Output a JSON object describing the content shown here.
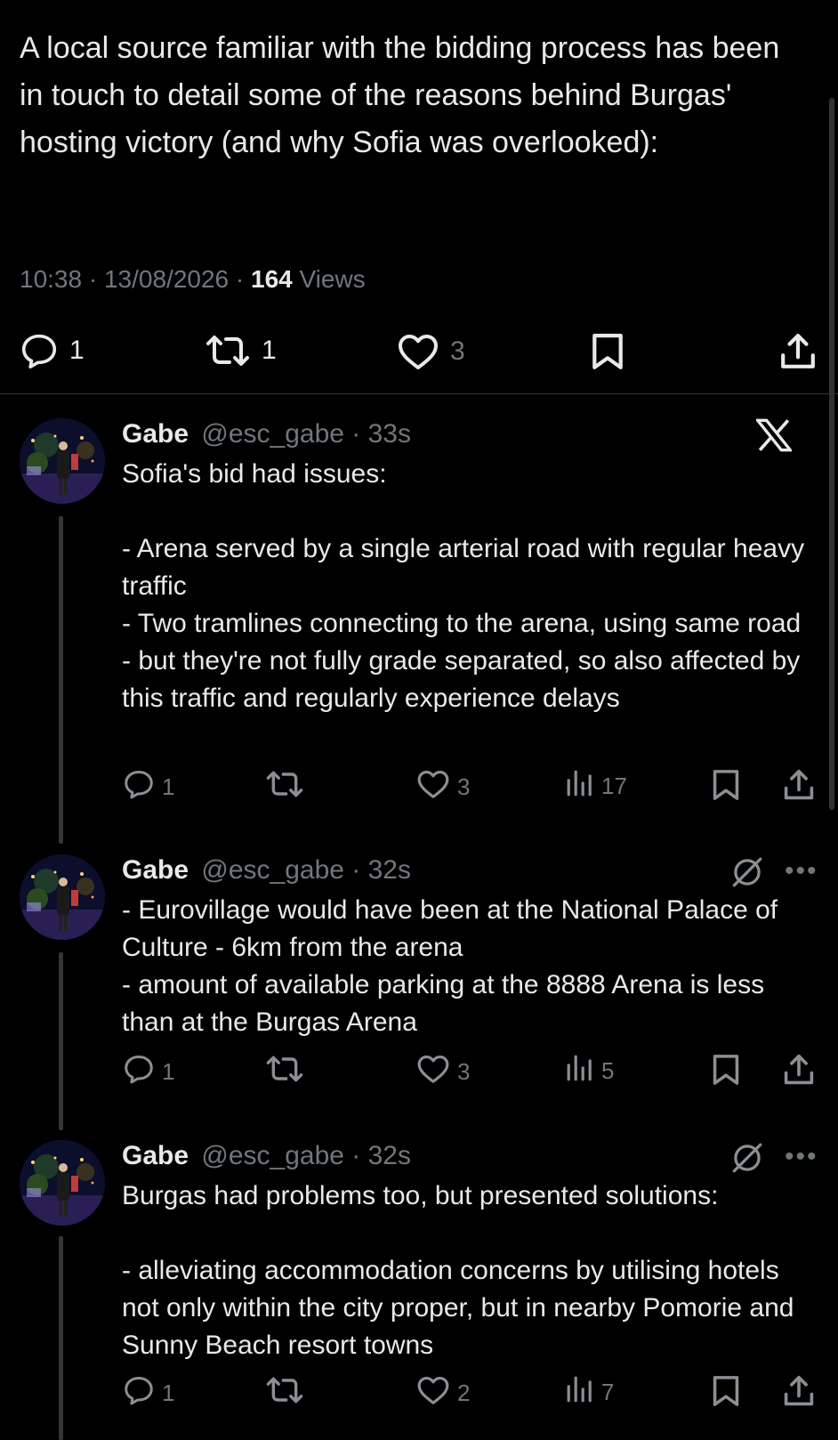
{
  "main_tweet": {
    "text": "A local source familiar with the bidding process has been in touch to detail some of the reasons behind Burgas' hosting victory (and why Sofia was overlooked):",
    "time": "10:38",
    "date": "13/08/2026",
    "views_count": "164",
    "views_label": "Views",
    "separator": "·",
    "actions": {
      "reply_count": "1",
      "retweet_count": "1",
      "like_count": "3"
    }
  },
  "replies": [
    {
      "name": "Gabe",
      "handle": "@esc_gabe",
      "time": "· 33s",
      "text": "Sofia's bid had issues:\n\n- Arena served by a single arterial road with regular heavy traffic\n- Two tramlines connecting to the arena, using same road - but they're not fully grade separated, so also affected by this traffic and regularly experience delays",
      "reply_count": "1",
      "retweet_count": "",
      "like_count": "3",
      "views_count": "17"
    },
    {
      "name": "Gabe",
      "handle": "@esc_gabe",
      "time": "· 32s",
      "text": "- Eurovillage would have been at the National Palace of Culture - 6km from the arena\n- amount of available parking at the 8888 Arena is less than at the Burgas Arena",
      "reply_count": "1",
      "retweet_count": "",
      "like_count": "3",
      "views_count": "5"
    },
    {
      "name": "Gabe",
      "handle": "@esc_gabe",
      "time": "· 32s",
      "text": "Burgas had problems too, but presented solutions:\n\n- alleviating accommodation concerns by utilising hotels not only within the city proper, but in nearby Pomorie and Sunny Beach resort towns",
      "reply_count": "1",
      "retweet_count": "",
      "like_count": "2",
      "views_count": "7"
    }
  ],
  "more_glyph": "•••",
  "icons": {
    "reply": "reply-icon",
    "retweet": "retweet-icon",
    "like": "heart-icon",
    "bookmark": "bookmark-icon",
    "share": "share-icon",
    "views": "views-icon",
    "x_logo": "x-logo-icon",
    "grok": "grok-icon"
  },
  "colors": {
    "background": "#000000",
    "text": "#e7e9ea",
    "muted": "#71767b",
    "divider": "#2f3336"
  }
}
